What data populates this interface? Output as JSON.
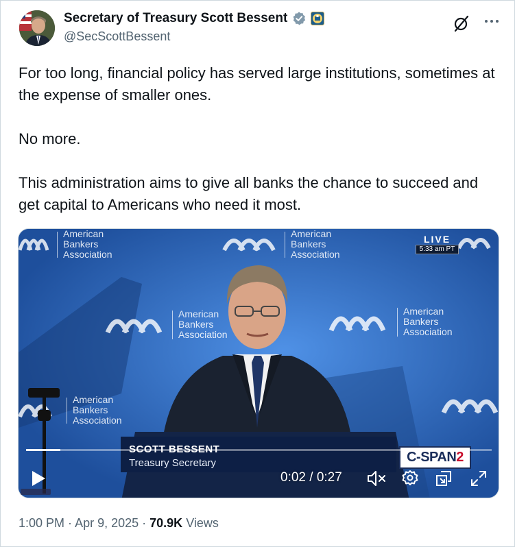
{
  "author": {
    "display_name": "Secretary of Treasury Scott Bessent",
    "handle": "@SecScottBessent"
  },
  "tweet": {
    "text": "For too long, financial policy has served large institutions, sometimes at the expense of smaller ones.\n\nNo more.\n\nThis administration aims to give all banks the chance to succeed and get capital to Americans who need it most."
  },
  "video": {
    "backdrop_logo": "American\nBankers\nAssociation",
    "live_label": "LIVE",
    "live_time": "5:33 am PT",
    "lower_third_name": "SCOTT BESSENT",
    "lower_third_title": "Treasury Secretary",
    "network_c": "C-SPAN",
    "network_2": "2",
    "time_readout": "0:02 / 0:27",
    "progress_fraction": 0.074
  },
  "meta": {
    "time": "1:00 PM",
    "separator": " · ",
    "date": "Apr 9, 2025",
    "views_count": "70.9K",
    "views_label": " Views"
  },
  "icons": {
    "verified": "verified-badge-icon",
    "affiliate": "treasury-seal-icon",
    "grok": "grok-icon",
    "more": "more-icon",
    "play": "play-icon",
    "mute": "mute-icon",
    "settings": "gear-icon",
    "pip": "picture-in-picture-icon",
    "fullscreen": "expand-icon"
  },
  "colors": {
    "verified": "#829aab",
    "text": "#0f1419",
    "muted": "#536471"
  }
}
